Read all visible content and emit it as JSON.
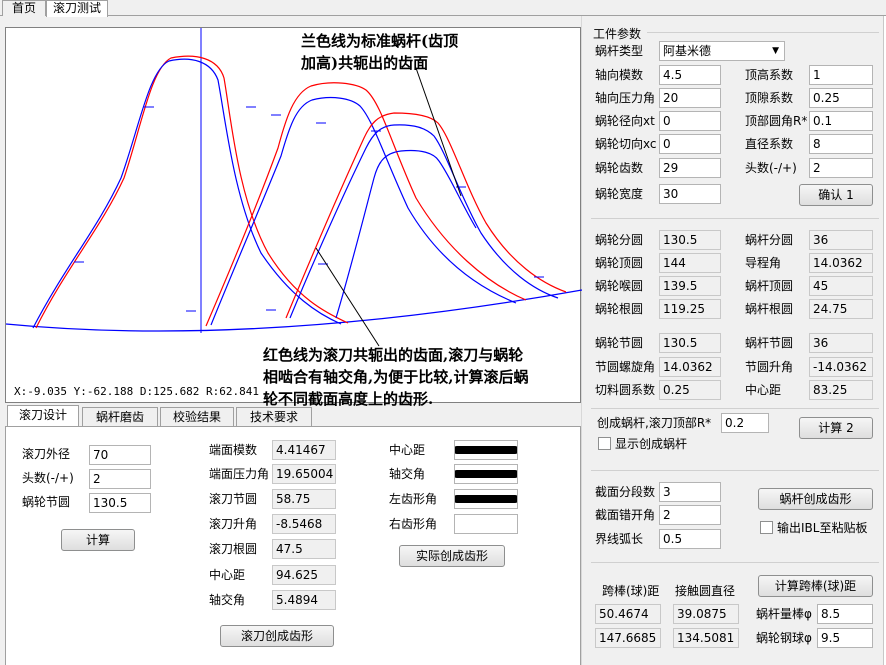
{
  "top_tabs": [
    "首页",
    "滚刀测试"
  ],
  "plot": {
    "note_blue": [
      "兰色线为标准蜗杆(齿顶",
      "加高)共轭出的齿面"
    ],
    "note_red": [
      "红色线为滚刀共轭出的齿面,滚刀与蜗轮",
      "相啮合有轴交角,为便于比较,计算滚后蜗",
      "轮不同截面高度上的齿形."
    ],
    "coord": "X:-9.035  Y:-62.188 D:125.682 R:62.841",
    "colors": {
      "red": "#ff0000",
      "blue": "#0000ff"
    }
  },
  "panel_tabs": [
    "滚刀设计",
    "蜗杆磨齿",
    "校验结果",
    "技术要求"
  ],
  "hob": {
    "outer_dia_label": "滚刀外径",
    "outer_dia": "70",
    "starts_label": "头数(-/+)",
    "starts": "2",
    "gear_pitch_label": "蜗轮节圆",
    "gear_pitch": "130.5",
    "calc_btn": "计算",
    "end_module_label": "端面模数",
    "end_module": "4.41467",
    "end_pa_label": "端面压力角",
    "end_pa": "19.65004",
    "hob_pitch_label": "滚刀节圆",
    "hob_pitch": "58.75",
    "hob_lead_label": "滚刀升角",
    "hob_lead": "-8.5468",
    "hob_root_label": "滚刀根圆",
    "hob_root": "47.5",
    "center_label": "中心距",
    "center": "94.625",
    "shaft_label": "轴交角",
    "shaft": "5.4894",
    "gen_btn": "滚刀创成齿形",
    "c_dist_label": "中心距",
    "c_shaft_label": "轴交角",
    "c_left_label": "左齿形角",
    "c_right_label": "右齿形角",
    "actual_btn": "实际创成齿形"
  },
  "params": {
    "title": "工件参数",
    "worm_type_label": "蜗杆类型",
    "worm_type": "阿基米德",
    "axial_module_label": "轴向模数",
    "axial_module": "4.5",
    "addendum_label": "顶高系数",
    "addendum": "1",
    "axial_pa_label": "轴向压力角",
    "axial_pa": "20",
    "clearance_label": "顶隙系数",
    "clearance": "0.25",
    "radial_label": "蜗轮径向xt",
    "radial": "0",
    "tip_r_label": "顶部圆角R*",
    "tip_r": "0.1",
    "tangent_label": "蜗轮切向xc",
    "tangent": "0",
    "dia_coef_label": "直径系数",
    "dia_coef": "8",
    "teeth_label": "蜗轮齿数",
    "teeth": "29",
    "starts_label": "头数(-/+)",
    "starts": "2",
    "width_label": "蜗轮宽度",
    "width": "30",
    "confirm_btn": "确认 1",
    "gear_ref_label": "蜗轮分圆",
    "gear_ref": "130.5",
    "worm_ref_label": "蜗杆分圆",
    "worm_ref": "36",
    "gear_tip_label": "蜗轮顶圆",
    "gear_tip": "144",
    "lead_angle_label": "导程角",
    "lead_angle": "14.0362",
    "gear_throat_label": "蜗轮喉圆",
    "gear_throat": "139.5",
    "worm_tip_label": "蜗杆顶圆",
    "worm_tip": "45",
    "gear_root_label": "蜗轮根圆",
    "gear_root": "119.25",
    "worm_root_label": "蜗杆根圆",
    "worm_root": "24.75",
    "gear_pitch_label": "蜗轮节圆",
    "gear_pitch": "130.5",
    "worm_pitch_label": "蜗杆节圆",
    "worm_pitch": "36",
    "pitch_helix_label": "节圆螺旋角",
    "pitch_helix": "14.0362",
    "pitch_lead_label": "节圆升角",
    "pitch_lead": "-14.0362",
    "cut_coef_label": "切料圆系数",
    "cut_coef": "0.25",
    "center_label": "中心距",
    "center": "83.25",
    "gen_worm_label": "创成蜗杆,滚刀顶部R*",
    "gen_worm_r": "0.2",
    "calc2_btn": "计算 2",
    "show_worm_label": "显示创成蜗杆",
    "sections_label": "截面分段数",
    "sections": "3",
    "section_offset_label": "截面错开角",
    "section_offset": "2",
    "boundary_label": "界线弧长",
    "boundary": "0.5",
    "worm_gen_btn": "蜗杆创成齿形",
    "ibl_label": "输出IBL至粘贴板",
    "span_label": "跨棒(球)距",
    "contact_label": "接触圆直径",
    "span_calc_btn": "计算跨棒(球)距",
    "span1": "50.4674",
    "contact1": "39.0875",
    "span2": "147.6685",
    "contact2": "134.5081",
    "worm_rod_label": "蜗杆量棒φ",
    "worm_rod": "8.5",
    "gear_ball_label": "蜗轮钢球φ",
    "gear_ball": "9.5"
  }
}
